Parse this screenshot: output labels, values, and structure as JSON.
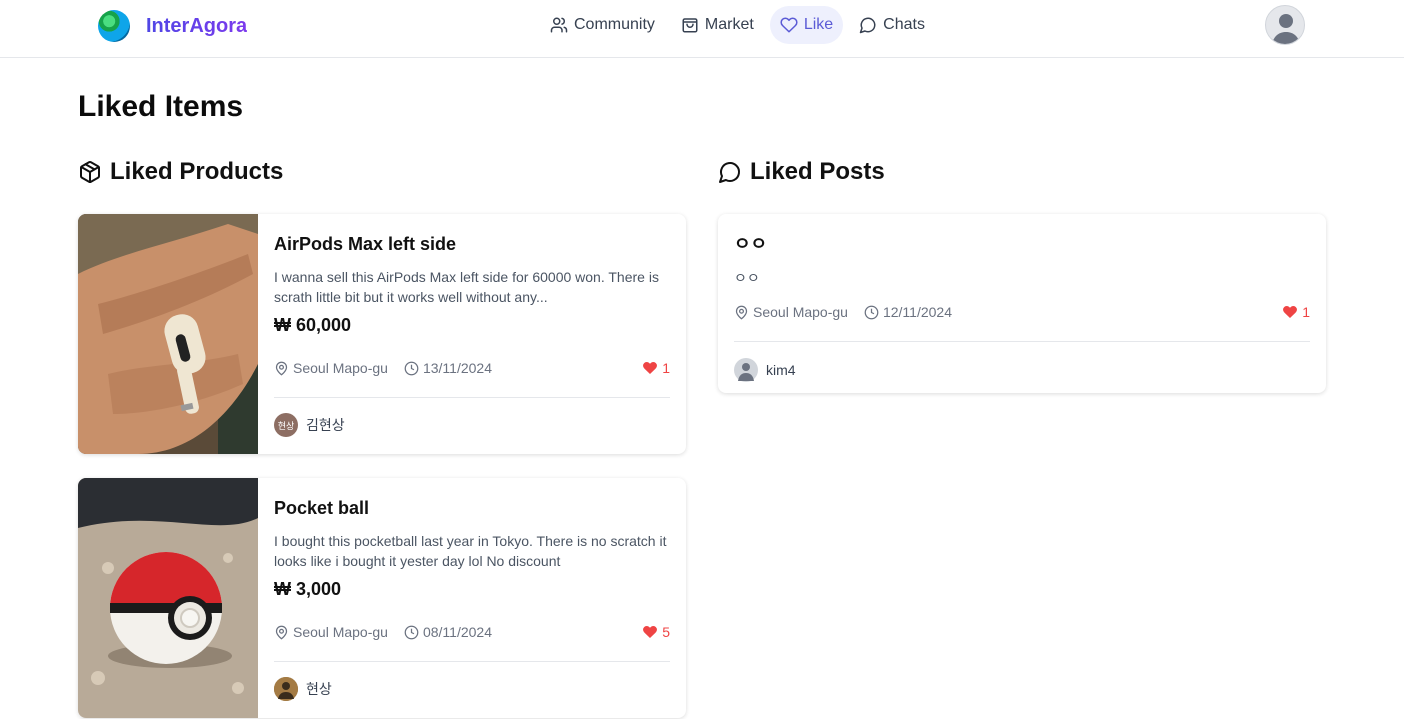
{
  "header": {
    "brand": "InterAgora",
    "nav": [
      {
        "label": "Community",
        "icon": "users-icon"
      },
      {
        "label": "Market",
        "icon": "shopping-bag-icon"
      },
      {
        "label": "Like",
        "icon": "heart-icon",
        "active": true
      },
      {
        "label": "Chats",
        "icon": "chat-bubble-icon"
      }
    ]
  },
  "page": {
    "title": "Liked Items",
    "products_heading": "Liked Products",
    "posts_heading": "Liked Posts"
  },
  "products": [
    {
      "title": "AirPods Max left side",
      "description": "I wanna sell this AirPods Max left side for 60000 won. There is scrath little bit but it works well without any...",
      "price": "₩ 60,000",
      "location": "Seoul Mapo-gu",
      "date": "13/11/2024",
      "likes": "1",
      "seller_name": "김현상",
      "seller_avatar_text": "현상"
    },
    {
      "title": "Pocket ball",
      "description": "I bought this pocketball last year in Tokyo. There is no scratch it looks like i bought it yester day lol No discount",
      "price": "₩ 3,000",
      "location": "Seoul Mapo-gu",
      "date": "08/11/2024",
      "likes": "5",
      "seller_name": "현상"
    }
  ],
  "posts": [
    {
      "title": "ㅇㅇ",
      "body": "ㅇㅇ",
      "location": "Seoul Mapo-gu",
      "date": "12/11/2024",
      "likes": "1",
      "author": "kim4"
    }
  ],
  "colors": {
    "accent": "#5b5bd6",
    "active_nav_bg": "#eef0fd",
    "like_red": "#ef4444"
  }
}
